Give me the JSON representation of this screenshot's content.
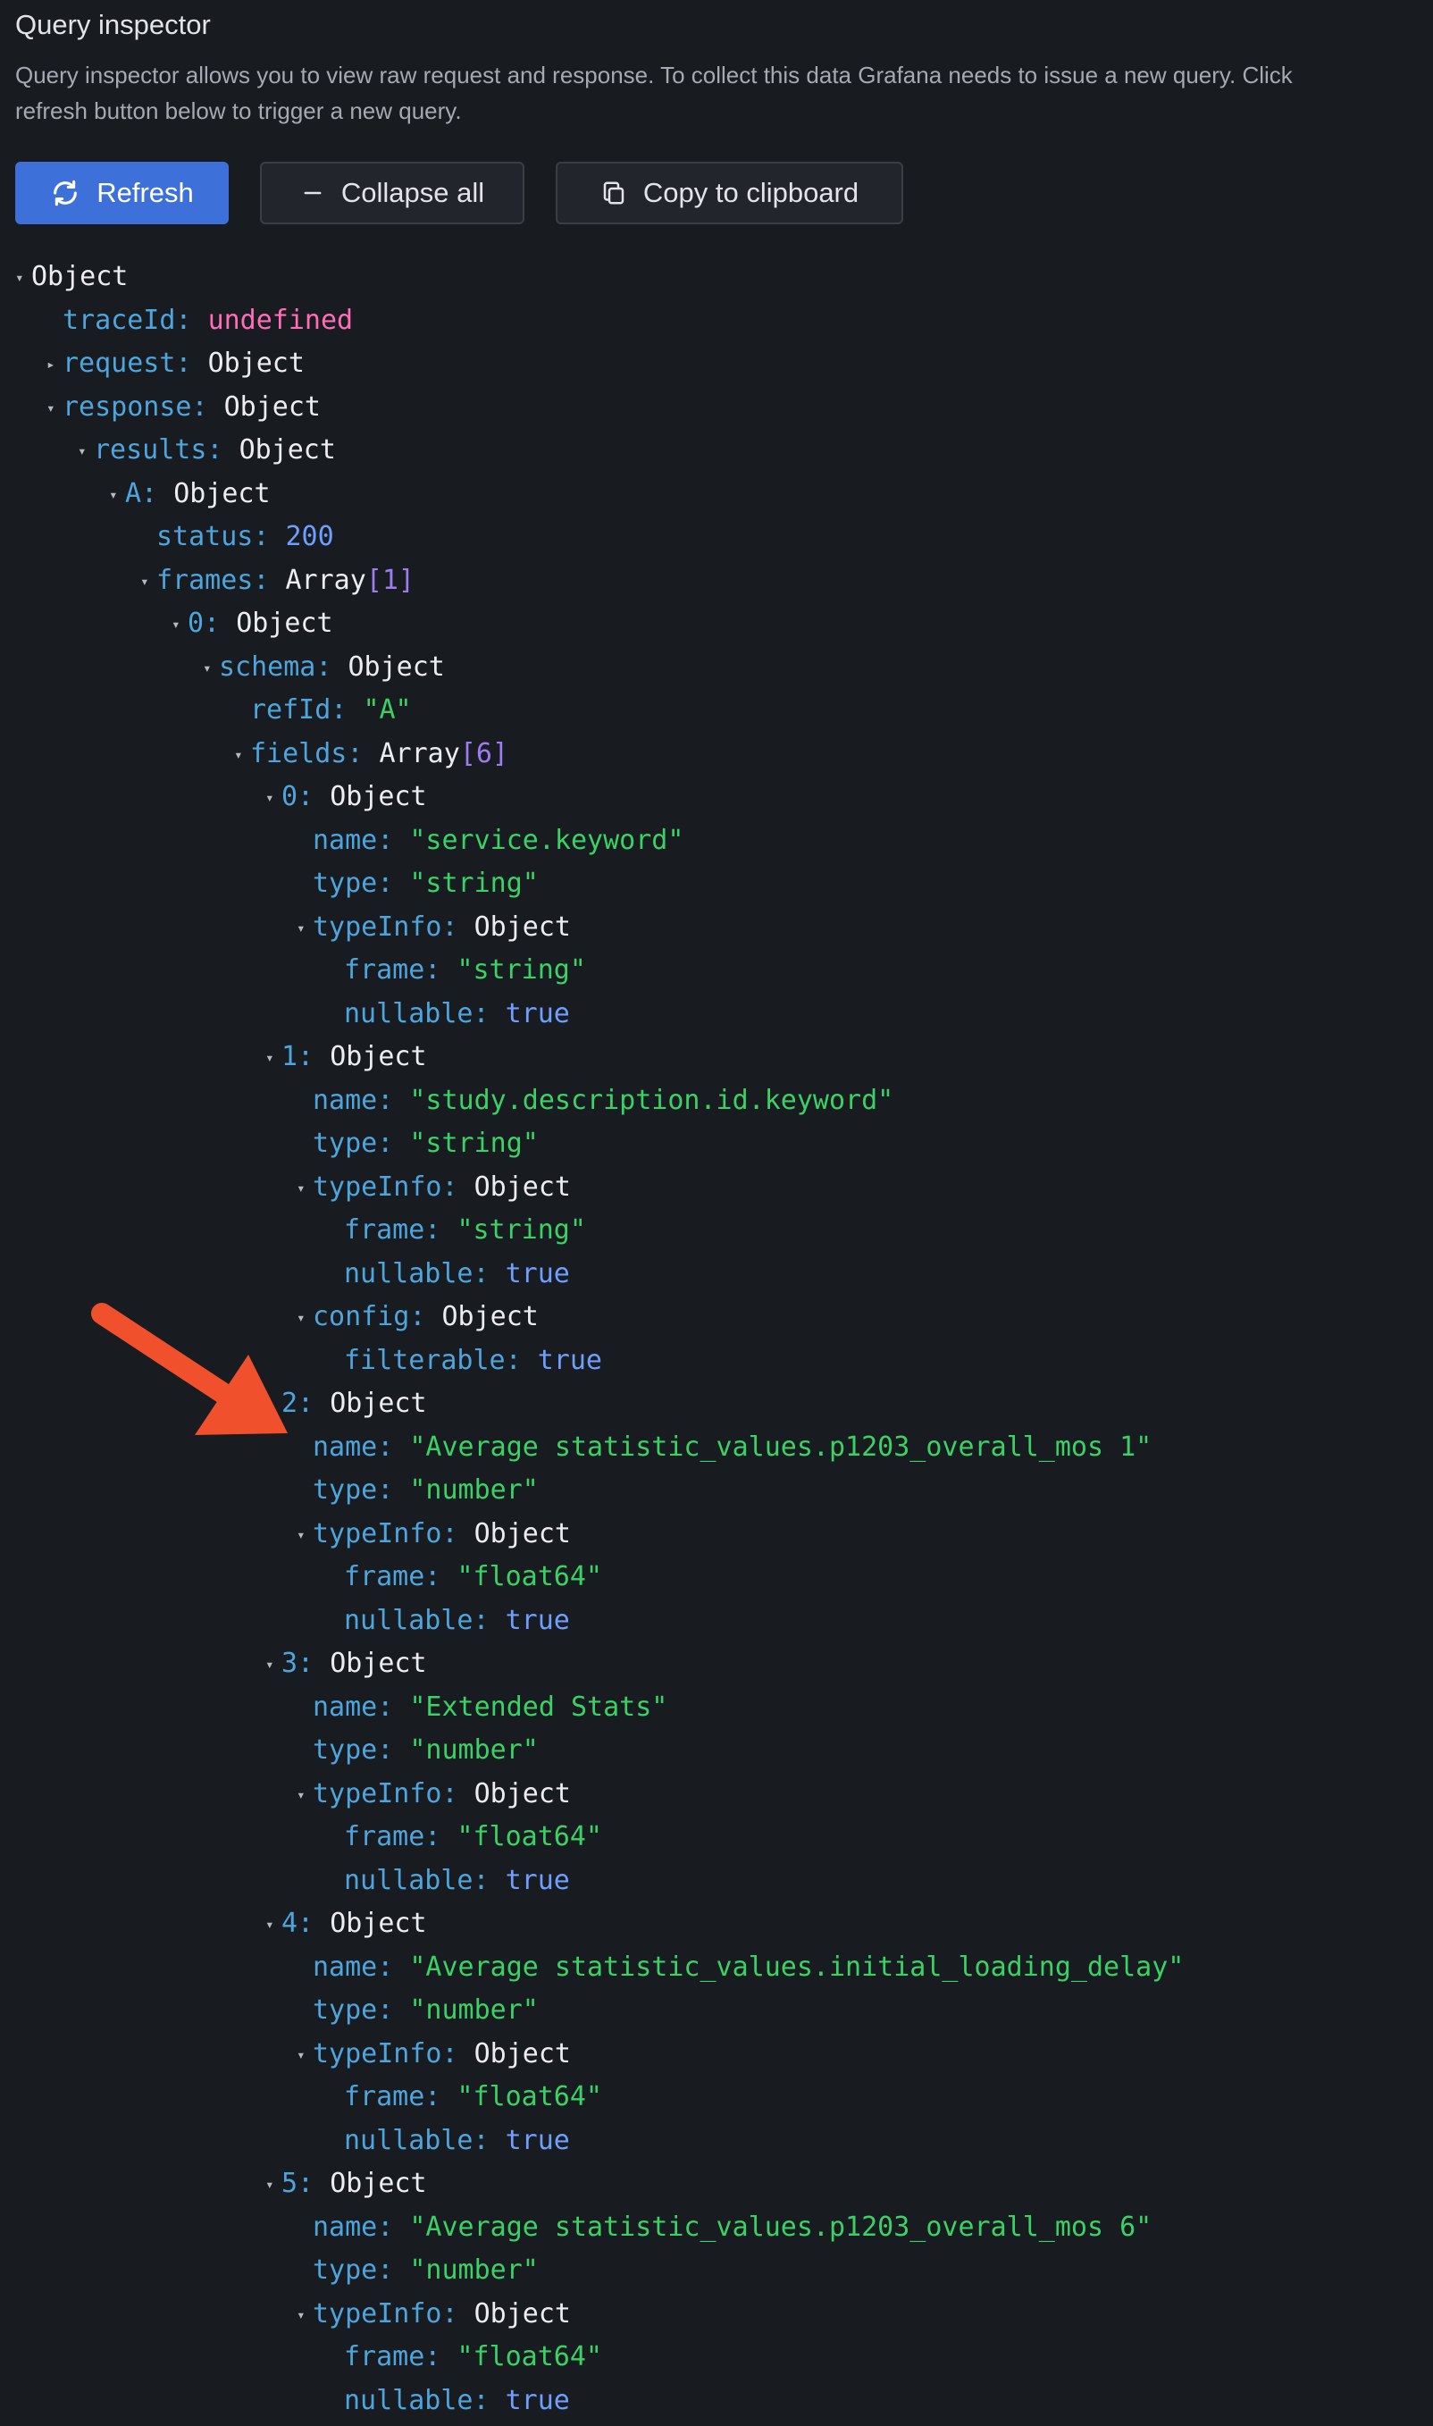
{
  "header": {
    "title": "Query inspector",
    "description_line1": "Query inspector allows you to view raw request and response. To collect this data Grafana needs to issue a new query. Click",
    "description_line2": "refresh button below to trigger a new query."
  },
  "toolbar": {
    "refresh_label": "Refresh",
    "refresh_icon": "sync-icon",
    "collapse_label": "Collapse all",
    "collapse_icon": "minus-icon",
    "copy_label": "Copy to clipboard",
    "copy_icon": "copy-icon"
  },
  "colors": {
    "background": "#181b1f",
    "primary_button": "#3d71d9",
    "key": "#4ea5dd",
    "string": "#3ad265",
    "number_bool": "#6e9fff",
    "undefined": "#ff6cb8",
    "annotation_arrow": "#f0502b"
  },
  "tree": [
    {
      "depth": 0,
      "toggle": "expanded",
      "key": "",
      "value": "Object",
      "kind": "object"
    },
    {
      "depth": 1,
      "toggle": "none",
      "key": "traceId:",
      "value": "undefined",
      "kind": "undefined"
    },
    {
      "depth": 1,
      "toggle": "collapsed",
      "key": "request:",
      "value": "Object",
      "kind": "object"
    },
    {
      "depth": 1,
      "toggle": "expanded",
      "key": "response:",
      "value": "Object",
      "kind": "object"
    },
    {
      "depth": 2,
      "toggle": "expanded",
      "key": "results:",
      "value": "Object",
      "kind": "object"
    },
    {
      "depth": 3,
      "toggle": "expanded",
      "key": "A:",
      "value": "Object",
      "kind": "object"
    },
    {
      "depth": 4,
      "toggle": "none",
      "key": "status:",
      "value": "200",
      "kind": "number"
    },
    {
      "depth": 4,
      "toggle": "expanded",
      "key": "frames:",
      "value": "Array",
      "count": "[1]",
      "kind": "array"
    },
    {
      "depth": 5,
      "toggle": "expanded",
      "key": "0:",
      "value": "Object",
      "kind": "object"
    },
    {
      "depth": 6,
      "toggle": "expanded",
      "key": "schema:",
      "value": "Object",
      "kind": "object"
    },
    {
      "depth": 7,
      "toggle": "none",
      "key": "refId:",
      "value": "\"A\"",
      "kind": "string"
    },
    {
      "depth": 7,
      "toggle": "expanded",
      "key": "fields:",
      "value": "Array",
      "count": "[6]",
      "kind": "array"
    },
    {
      "depth": 8,
      "toggle": "expanded",
      "key": "0:",
      "value": "Object",
      "kind": "object"
    },
    {
      "depth": 9,
      "toggle": "none",
      "key": "name:",
      "value": "\"service.keyword\"",
      "kind": "string"
    },
    {
      "depth": 9,
      "toggle": "none",
      "key": "type:",
      "value": "\"string\"",
      "kind": "string"
    },
    {
      "depth": 9,
      "toggle": "expanded",
      "key": "typeInfo:",
      "value": "Object",
      "kind": "object"
    },
    {
      "depth": 10,
      "toggle": "none",
      "key": "frame:",
      "value": "\"string\"",
      "kind": "string"
    },
    {
      "depth": 10,
      "toggle": "none",
      "key": "nullable:",
      "value": "true",
      "kind": "bool"
    },
    {
      "depth": 8,
      "toggle": "expanded",
      "key": "1:",
      "value": "Object",
      "kind": "object"
    },
    {
      "depth": 9,
      "toggle": "none",
      "key": "name:",
      "value": "\"study.description.id.keyword\"",
      "kind": "string"
    },
    {
      "depth": 9,
      "toggle": "none",
      "key": "type:",
      "value": "\"string\"",
      "kind": "string"
    },
    {
      "depth": 9,
      "toggle": "expanded",
      "key": "typeInfo:",
      "value": "Object",
      "kind": "object"
    },
    {
      "depth": 10,
      "toggle": "none",
      "key": "frame:",
      "value": "\"string\"",
      "kind": "string"
    },
    {
      "depth": 10,
      "toggle": "none",
      "key": "nullable:",
      "value": "true",
      "kind": "bool"
    },
    {
      "depth": 9,
      "toggle": "expanded",
      "key": "config:",
      "value": "Object",
      "kind": "object"
    },
    {
      "depth": 10,
      "toggle": "none",
      "key": "filterable:",
      "value": "true",
      "kind": "bool"
    },
    {
      "depth": 8,
      "toggle": "expanded",
      "key": "2:",
      "value": "Object",
      "kind": "object"
    },
    {
      "depth": 9,
      "toggle": "none",
      "key": "name:",
      "value": "\"Average statistic_values.p1203_overall_mos 1\"",
      "kind": "string"
    },
    {
      "depth": 9,
      "toggle": "none",
      "key": "type:",
      "value": "\"number\"",
      "kind": "string"
    },
    {
      "depth": 9,
      "toggle": "expanded",
      "key": "typeInfo:",
      "value": "Object",
      "kind": "object"
    },
    {
      "depth": 10,
      "toggle": "none",
      "key": "frame:",
      "value": "\"float64\"",
      "kind": "string"
    },
    {
      "depth": 10,
      "toggle": "none",
      "key": "nullable:",
      "value": "true",
      "kind": "bool"
    },
    {
      "depth": 8,
      "toggle": "expanded",
      "key": "3:",
      "value": "Object",
      "kind": "object"
    },
    {
      "depth": 9,
      "toggle": "none",
      "key": "name:",
      "value": "\"Extended Stats\"",
      "kind": "string"
    },
    {
      "depth": 9,
      "toggle": "none",
      "key": "type:",
      "value": "\"number\"",
      "kind": "string"
    },
    {
      "depth": 9,
      "toggle": "expanded",
      "key": "typeInfo:",
      "value": "Object",
      "kind": "object"
    },
    {
      "depth": 10,
      "toggle": "none",
      "key": "frame:",
      "value": "\"float64\"",
      "kind": "string"
    },
    {
      "depth": 10,
      "toggle": "none",
      "key": "nullable:",
      "value": "true",
      "kind": "bool"
    },
    {
      "depth": 8,
      "toggle": "expanded",
      "key": "4:",
      "value": "Object",
      "kind": "object"
    },
    {
      "depth": 9,
      "toggle": "none",
      "key": "name:",
      "value": "\"Average statistic_values.initial_loading_delay\"",
      "kind": "string"
    },
    {
      "depth": 9,
      "toggle": "none",
      "key": "type:",
      "value": "\"number\"",
      "kind": "string"
    },
    {
      "depth": 9,
      "toggle": "expanded",
      "key": "typeInfo:",
      "value": "Object",
      "kind": "object"
    },
    {
      "depth": 10,
      "toggle": "none",
      "key": "frame:",
      "value": "\"float64\"",
      "kind": "string"
    },
    {
      "depth": 10,
      "toggle": "none",
      "key": "nullable:",
      "value": "true",
      "kind": "bool"
    },
    {
      "depth": 8,
      "toggle": "expanded",
      "key": "5:",
      "value": "Object",
      "kind": "object"
    },
    {
      "depth": 9,
      "toggle": "none",
      "key": "name:",
      "value": "\"Average statistic_values.p1203_overall_mos 6\"",
      "kind": "string"
    },
    {
      "depth": 9,
      "toggle": "none",
      "key": "type:",
      "value": "\"number\"",
      "kind": "string"
    },
    {
      "depth": 9,
      "toggle": "expanded",
      "key": "typeInfo:",
      "value": "Object",
      "kind": "object"
    },
    {
      "depth": 10,
      "toggle": "none",
      "key": "frame:",
      "value": "\"float64\"",
      "kind": "string"
    },
    {
      "depth": 10,
      "toggle": "none",
      "key": "nullable:",
      "value": "true",
      "kind": "bool"
    }
  ]
}
